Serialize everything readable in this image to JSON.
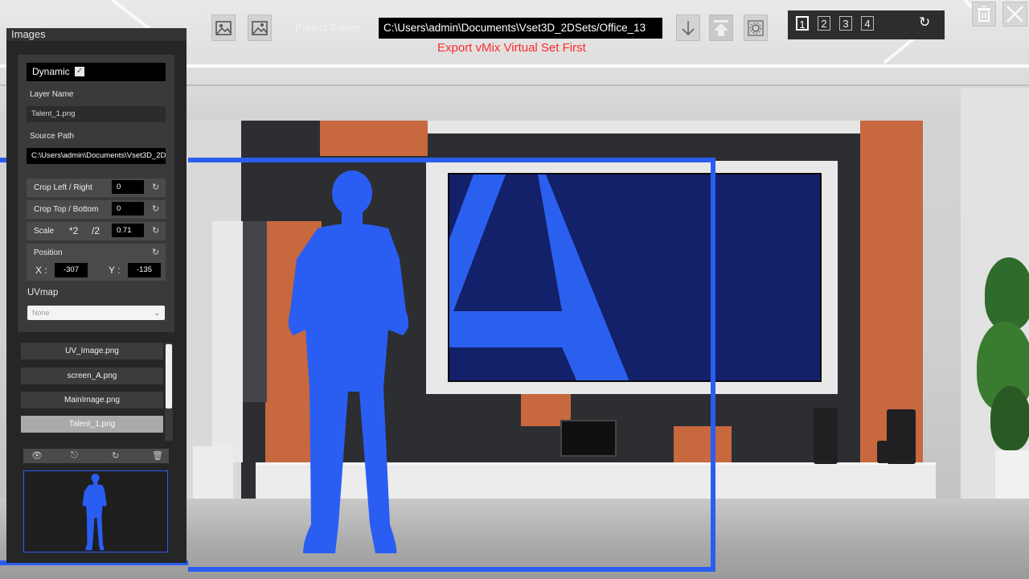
{
  "panel": {
    "title": "Images",
    "dynamic_label": "Dynamic",
    "dynamic_checked": true,
    "layer_name_label": "Layer Name",
    "layer_name_value": "Talent_1.png",
    "source_path_label": "Source Path",
    "source_path_value": "C:\\Users\\admin\\Documents\\Vset3D_2D",
    "crop_lr_label": "Crop Left / Right",
    "crop_lr_value": "0",
    "crop_tb_label": "Crop Top / Bottom",
    "crop_tb_value": "0",
    "scale_label": "Scale",
    "scale_x2": "*2",
    "scale_div2": "/2",
    "scale_value": "0.71",
    "position_label": "Position",
    "x_label": "X :",
    "x_value": "-307",
    "y_label": "Y :",
    "y_value": "-135",
    "uvmap_label": "UVmap",
    "uvmap_selected": "None",
    "images": [
      {
        "label": "UV_Image.png",
        "selected": false
      },
      {
        "label": "screen_A.png",
        "selected": false
      },
      {
        "label": "MainImage.png",
        "selected": false
      },
      {
        "label": "Talent_1.png",
        "selected": true
      }
    ],
    "tool_icons": [
      "eye-icon",
      "unlock-icon",
      "refresh-icon",
      "trash-icon"
    ]
  },
  "toolbar": {
    "folder_label": "Project Folder :",
    "folder_value": "C:\\Users\\admin\\Documents\\Vset3D_2DSets/Office_13",
    "warning": "Export vMix Virtual Set First",
    "pages": [
      "1",
      "2",
      "3",
      "4"
    ],
    "active_page": "1",
    "icons": [
      "add-image-icon",
      "add-dynamic-image-icon",
      "import-icon",
      "export-icon",
      "settings-icon",
      "refresh-icon",
      "trash-icon",
      "close-icon"
    ]
  },
  "colors": {
    "accent_blue": "#2a5ef3",
    "warning_red": "#ff2a2a",
    "tv_navy": "#13206a"
  }
}
